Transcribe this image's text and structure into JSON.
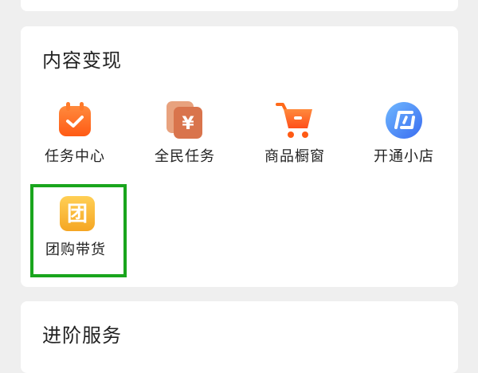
{
  "sections": {
    "content_monetization": {
      "title": "内容变现",
      "items": [
        {
          "label": "任务中心",
          "icon": "task-calendar-icon"
        },
        {
          "label": "全民任务",
          "icon": "yuan-coupon-icon"
        },
        {
          "label": "商品橱窗",
          "icon": "shopping-cart-icon"
        },
        {
          "label": "开通小店",
          "icon": "shop-logo-icon"
        },
        {
          "label": "团购带货",
          "icon": "group-buy-icon",
          "glyph": "团"
        }
      ],
      "coupon_glyph": "¥"
    },
    "advanced_services": {
      "title": "进阶服务"
    }
  },
  "colors": {
    "highlight": "#19a51d",
    "orange": "#ff6a1a",
    "gold": "#f7b733",
    "blue": "#3a7bf5"
  }
}
